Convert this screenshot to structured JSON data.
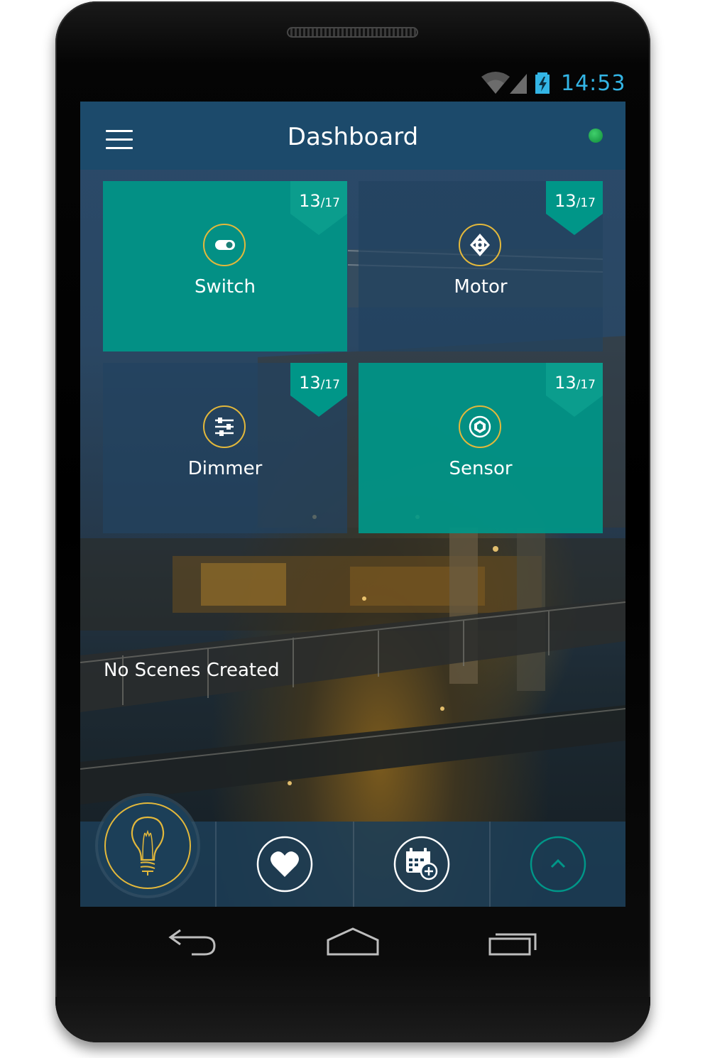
{
  "status_bar": {
    "time": "14:53",
    "icons": [
      "wifi-icon",
      "signal-icon",
      "battery-charging-icon"
    ],
    "time_color": "#33b5e5"
  },
  "app_bar": {
    "title": "Dashboard",
    "menu_icon": "hamburger-menu-icon",
    "connection_status_color": "#2fbf5a"
  },
  "tiles": [
    {
      "label": "Switch",
      "count": "13",
      "total": "/17",
      "icon": "toggle-switch-icon",
      "style": "teal"
    },
    {
      "label": "Motor",
      "count": "13",
      "total": "/17",
      "icon": "motor-direction-icon",
      "style": "dark"
    },
    {
      "label": "Dimmer",
      "count": "13",
      "total": "/17",
      "icon": "sliders-icon",
      "style": "dark"
    },
    {
      "label": "Sensor",
      "count": "13",
      "total": "/17",
      "icon": "sensor-icon",
      "style": "teal"
    }
  ],
  "scenes": {
    "empty_message": "No Scenes Created"
  },
  "bottom_bar": {
    "items": [
      "lightbulb-icon",
      "heart-icon",
      "calendar-add-icon",
      "chevron-up-icon"
    ]
  },
  "nav_bar": {
    "items": [
      "back-icon",
      "home-icon",
      "recents-icon"
    ]
  },
  "colors": {
    "teal": "#009688",
    "gold": "#e3b83b",
    "appbar": "#1c4a6b"
  }
}
